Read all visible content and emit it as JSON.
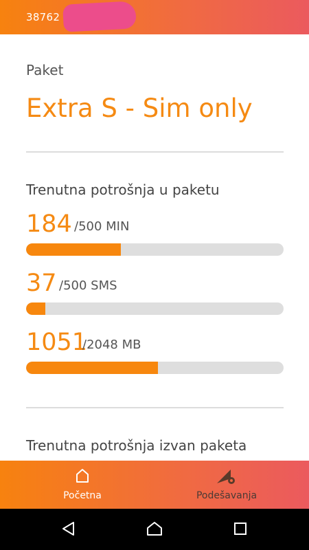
{
  "header": {
    "phone_prefix": "38762",
    "colors": {
      "gradient_start": "#f7820f",
      "gradient_end": "#eb5a5e"
    }
  },
  "package": {
    "label": "Paket",
    "name": "Extra S - Sim only"
  },
  "usage_section": {
    "title": "Trenutna potrošnja u paketu",
    "items": [
      {
        "used": "184",
        "total": "/500 MIN",
        "used_value": 184,
        "limit": 500
      },
      {
        "used": "37",
        "total": "/500 SMS",
        "used_value": 37,
        "limit": 500
      },
      {
        "used": "1051",
        "total": "/2048 MB",
        "used_value": 1051,
        "limit": 2048
      }
    ]
  },
  "outside_section": {
    "title": "Trenutna potrošnja izvan paketa"
  },
  "bottom_nav": {
    "home_label": "Početna",
    "home_icon": "home-icon",
    "settings_label": "Podešavanja",
    "settings_icon": "settings-icon"
  },
  "system_nav": {
    "back_icon": "back-icon",
    "home_icon": "home-icon",
    "recents_icon": "recents-icon"
  }
}
